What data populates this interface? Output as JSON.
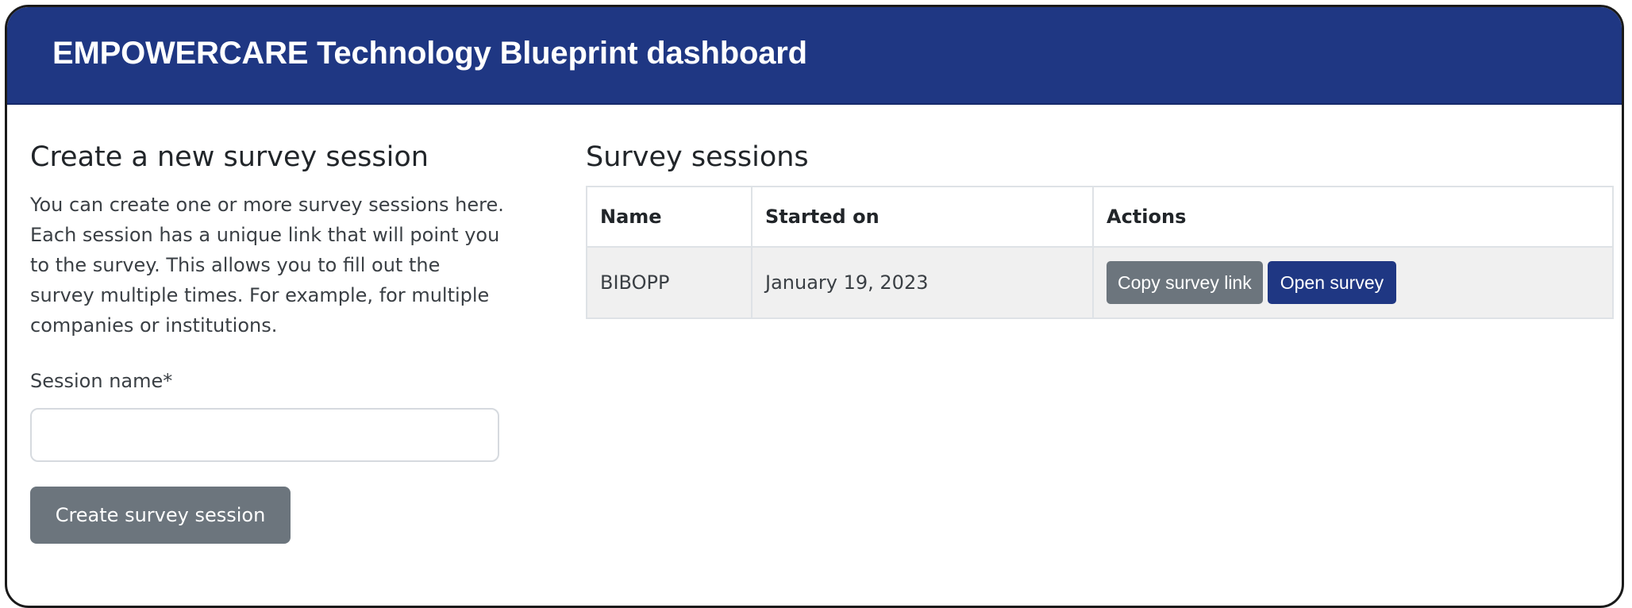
{
  "header": {
    "title": "EMPOWERCARE Technology Blueprint dashboard"
  },
  "create_form": {
    "heading": "Create a new survey session",
    "description": "You can create one or more survey sessions here. Each session has a unique link that will point you to the survey. This allows you to fill out the survey multiple times. For example, for multiple companies or institutions.",
    "session_name_label": "Session name*",
    "session_name_value": "",
    "submit_label": "Create survey session"
  },
  "sessions": {
    "heading": "Survey sessions",
    "columns": [
      "Name",
      "Started on",
      "Actions"
    ],
    "rows": [
      {
        "name": "BIBOPP",
        "started_on": "January 19, 2023",
        "copy_label": "Copy survey link",
        "open_label": "Open survey"
      }
    ]
  },
  "colors": {
    "navbar": "#1f3783",
    "primary_button": "#1f3783",
    "secondary_button": "#6c757d",
    "row_background": "#f0f0f0"
  }
}
